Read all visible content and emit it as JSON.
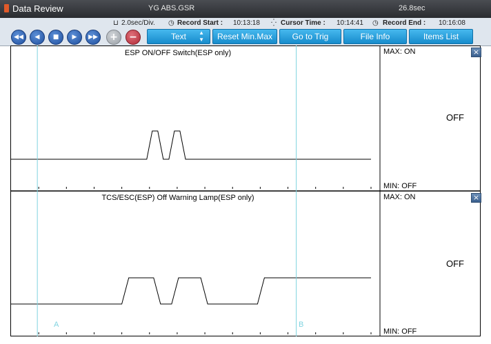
{
  "titlebar": {
    "app_title": "Data Review",
    "file_name": "YG ABS.GSR",
    "duration": "26.8sec"
  },
  "infobar": {
    "div_value": "2.0sec/Div.",
    "record_start_label": "Record Start :",
    "record_start_value": "10:13:18",
    "cursor_time_label": "Cursor Time :",
    "cursor_time_value": "10:14:41",
    "record_end_label": "Record End :",
    "record_end_value": "10:16:08"
  },
  "toolbar": {
    "display_mode": "Text",
    "reset_label": "Reset Min.Max",
    "goto_trig_label": "Go to Trig",
    "file_info_label": "File Info",
    "items_list_label": "Items List"
  },
  "cursors": {
    "a_label": "A",
    "b_label": "B"
  },
  "charts": [
    {
      "title": "ESP ON/OFF Switch(ESP only)",
      "max_label": "MAX: ON",
      "min_label": "MIN: OFF",
      "current_value": "OFF",
      "close_icon": "×"
    },
    {
      "title": "TCS/ESC(ESP) Off Warning Lamp(ESP only)",
      "max_label": "MAX: ON",
      "min_label": "MIN: OFF",
      "current_value": "OFF",
      "close_icon": "×"
    }
  ],
  "chart_data": [
    {
      "type": "line",
      "title": "ESP ON/OFF Switch(ESP only)",
      "y_states": [
        "OFF",
        "ON"
      ],
      "x_divisions": 13,
      "series": [
        {
          "values": [
            [
              0,
              0
            ],
            [
              4.9,
              0
            ],
            [
              5.1,
              1
            ],
            [
              5.3,
              1
            ],
            [
              5.5,
              0
            ],
            [
              5.7,
              0
            ],
            [
              5.9,
              1
            ],
            [
              6.1,
              1
            ],
            [
              6.3,
              0
            ],
            [
              13,
              0
            ]
          ]
        }
      ],
      "cursor_a_div": 0.95,
      "cursor_b_div": 10.3
    },
    {
      "type": "line",
      "title": "TCS/ESC(ESP) Off Warning Lamp(ESP only)",
      "y_states": [
        "OFF",
        "ON"
      ],
      "x_divisions": 13,
      "series": [
        {
          "values": [
            [
              0,
              0
            ],
            [
              4,
              0
            ],
            [
              4.25,
              1
            ],
            [
              5.15,
              1
            ],
            [
              5.4,
              0
            ],
            [
              5.8,
              0
            ],
            [
              6.05,
              1
            ],
            [
              6.85,
              1
            ],
            [
              7.1,
              0
            ],
            [
              8.9,
              0
            ],
            [
              9.15,
              1
            ],
            [
              13,
              1
            ]
          ]
        }
      ],
      "cursor_a_div": 0.95,
      "cursor_b_div": 10.3
    }
  ]
}
